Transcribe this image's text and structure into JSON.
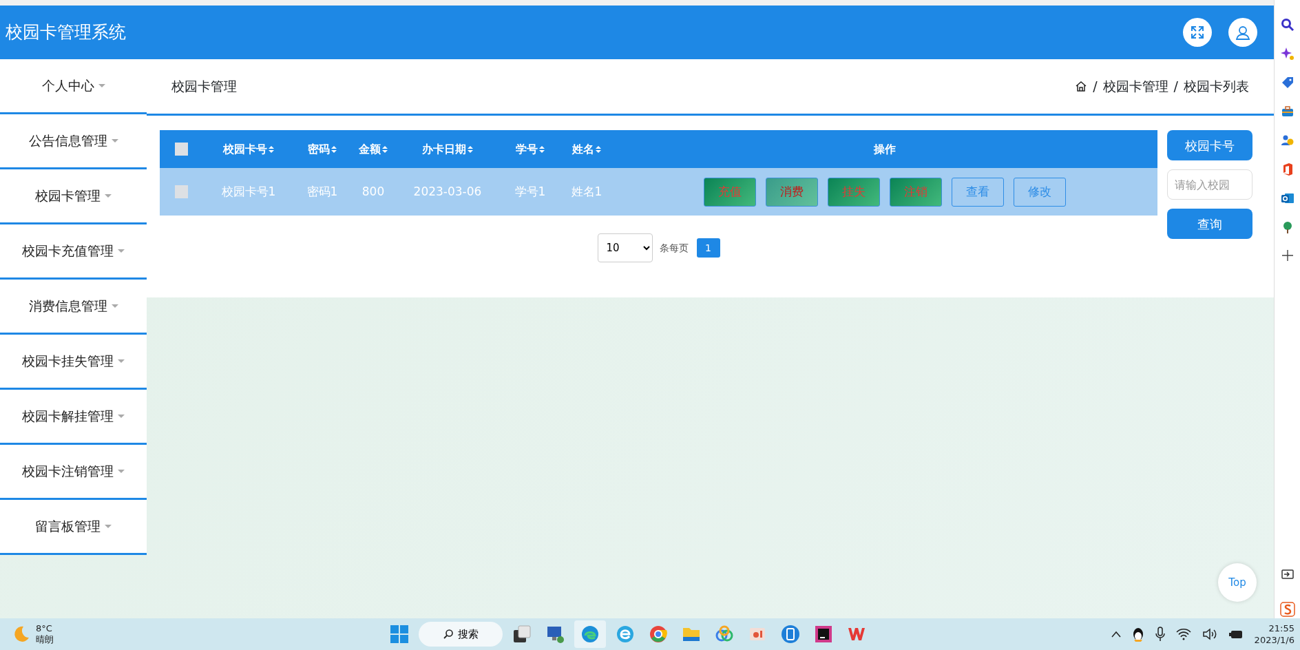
{
  "window": {
    "title": "校园卡管理系统"
  },
  "sidebar": {
    "items": [
      {
        "label": "个人中心"
      },
      {
        "label": "公告信息管理"
      },
      {
        "label": "校园卡管理"
      },
      {
        "label": "校园卡充值管理"
      },
      {
        "label": "消费信息管理"
      },
      {
        "label": "校园卡挂失管理"
      },
      {
        "label": "校园卡解挂管理"
      },
      {
        "label": "校园卡注销管理"
      },
      {
        "label": "留言板管理"
      }
    ]
  },
  "page": {
    "title": "校园卡管理",
    "breadcrumb": [
      "/",
      "校园卡管理",
      "/",
      "校园卡列表"
    ]
  },
  "table": {
    "header_checked": false,
    "columns": [
      {
        "label": "校园卡号",
        "sortable": true
      },
      {
        "label": "密码",
        "sortable": true
      },
      {
        "label": "金额",
        "sortable": true
      },
      {
        "label": "办卡日期",
        "sortable": true
      },
      {
        "label": "学号",
        "sortable": true
      },
      {
        "label": "姓名",
        "sortable": true
      },
      {
        "label": "操作",
        "sortable": false
      }
    ],
    "rows": [
      {
        "checked": false,
        "cells": [
          "校园卡号1",
          "密码1",
          "800",
          "2023-03-06",
          "学号1",
          "姓名1"
        ],
        "actions": [
          {
            "label": "充值",
            "kind": "filled",
            "hovered": false
          },
          {
            "label": "消费",
            "kind": "filled",
            "hovered": true
          },
          {
            "label": "挂失",
            "kind": "filled",
            "hovered": false
          },
          {
            "label": "注销",
            "kind": "filled",
            "hovered": false
          },
          {
            "label": "查看",
            "kind": "outline",
            "hovered": false
          },
          {
            "label": "修改",
            "kind": "outline",
            "hovered": false
          }
        ]
      }
    ]
  },
  "pagination": {
    "page_size": "10",
    "per_page_label": "条每页",
    "pages": [
      {
        "label": "1",
        "selected": true
      }
    ]
  },
  "search": {
    "field_label": "校园卡号",
    "placeholder": "请输入校园",
    "button": "查询"
  },
  "back_to_top": "Top",
  "taskbar": {
    "weather": {
      "temperature": "8°C",
      "condition": "晴朗"
    },
    "search_label": "搜索",
    "clock": {
      "time": "21:55",
      "date": "2023/1/6"
    }
  }
}
